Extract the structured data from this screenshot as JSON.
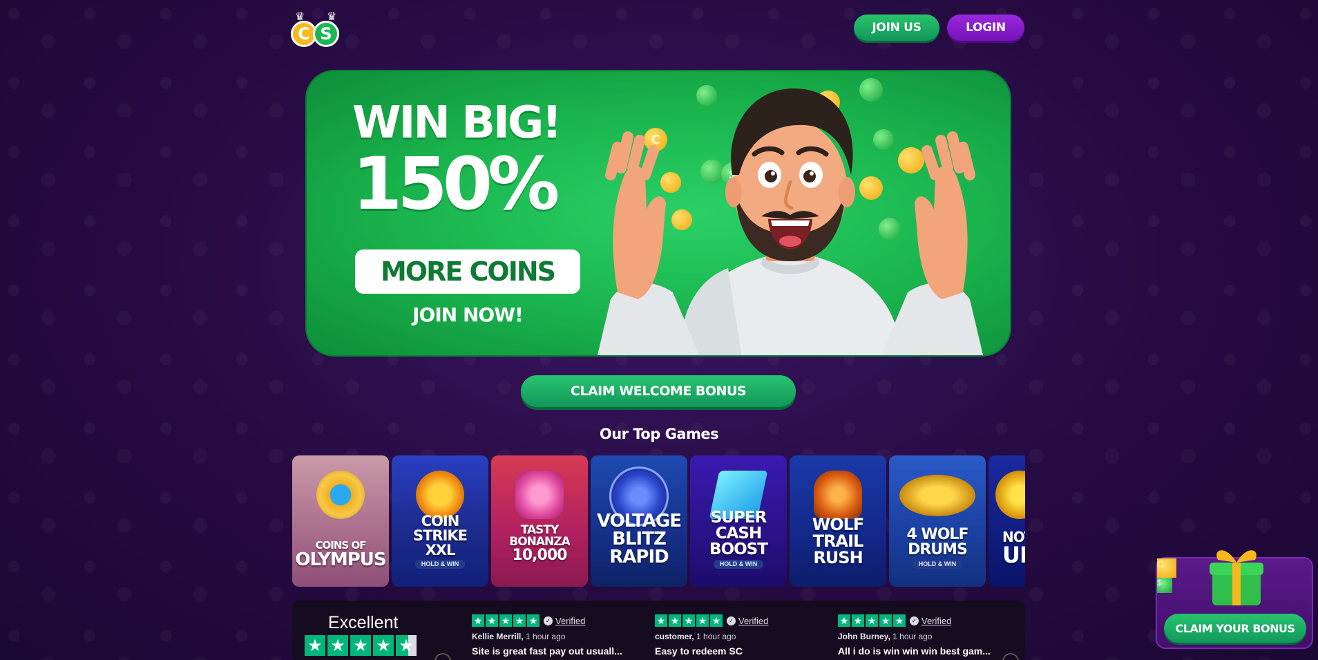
{
  "header": {
    "join_label": "JOIN US",
    "login_label": "LOGIN",
    "logo_letters": [
      "C",
      "S"
    ]
  },
  "hero": {
    "line1": "WIN BIG!",
    "line2": "150%",
    "pill": "MORE COINS",
    "cta": "JOIN NOW!",
    "coin_symbols": [
      "C",
      "$"
    ]
  },
  "claim_welcome_label": "CLAIM WELCOME BONUS",
  "top_games": {
    "title": "Our Top Games",
    "games": [
      {
        "line1": "COINS OF",
        "line2": "OLYMPUS",
        "tag": ""
      },
      {
        "line1": "COIN STRIKE",
        "line2": "XXL",
        "tag": "HOLD & WIN"
      },
      {
        "line1": "TASTY BONANZA",
        "line2": "10,000",
        "tag": ""
      },
      {
        "line1": "VOLTAGE",
        "line2": "BLITZ RAPID",
        "tag": ""
      },
      {
        "line1": "SUPER",
        "line2": "CASH BOOST",
        "tag": "HOLD & WIN"
      },
      {
        "line1": "WOLF",
        "line2": "TRAIL RUSH",
        "tag": ""
      },
      {
        "line1": "4 WOLF DRUMS",
        "line2": "",
        "tag": "HOLD & WIN"
      },
      {
        "line1": "NOV",
        "line2": "UI",
        "tag": ""
      }
    ]
  },
  "reviews": {
    "rating_word": "Excellent",
    "rating_stars": 4.5,
    "items": [
      {
        "stars": 5,
        "verified": "Verified",
        "author": "Kellie Merrill,",
        "time": "1 hour ago",
        "text": "Site is great fast pay out usuall..."
      },
      {
        "stars": 5,
        "verified": "Verified",
        "author": "customer,",
        "time": "1 hour ago",
        "text": "Easy to redeem SC"
      },
      {
        "stars": 5,
        "verified": "Verified",
        "author": "John Burney,",
        "time": "1 hour ago",
        "text": "All i do is win win win best gam..."
      }
    ]
  },
  "bonus_widget": {
    "button_label": "CLAIM YOUR BONUS"
  },
  "colors": {
    "background": "#260b42",
    "green_button": "#12975a",
    "purple_button": "#7513b8",
    "trustpilot_green": "#00b67a"
  }
}
